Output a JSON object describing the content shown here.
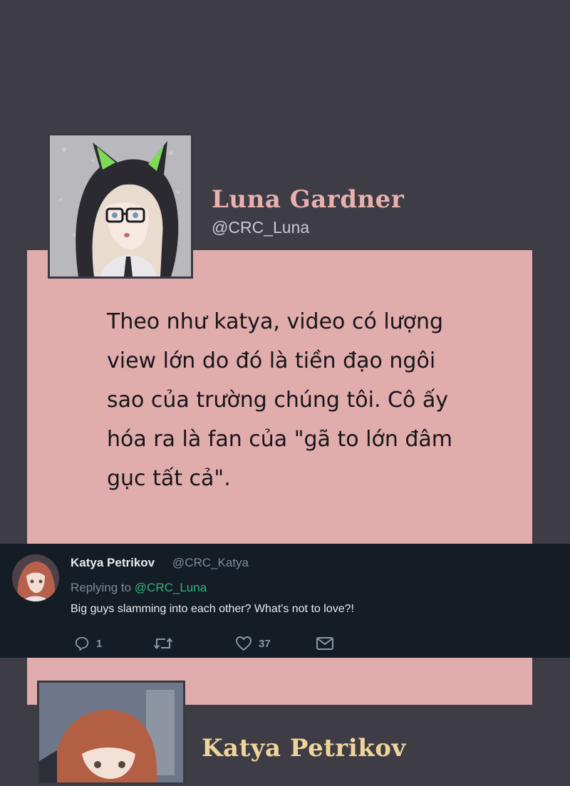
{
  "post": {
    "author_name": "Luna Gardner",
    "author_handle": "@CRC_Luna",
    "message": "Theo như katya, video có lượng view lớn do đó là tiền đạo ngôi sao của trường chúng tôi. Cô ấy hóa ra là fan của \"gã to lớn đâm gục tất cả\"."
  },
  "reply": {
    "author_name": "Katya Petrikov",
    "author_handle": "@CRC_Katya",
    "replying_prefix": "Replying to",
    "replying_to": "@CRC_Luna",
    "text": "Big guys slamming into each other? What's not to love?!",
    "actions": {
      "reply_icon": "reply-icon",
      "reply_count": "1",
      "retweet_icon": "retweet-icon",
      "retweet_count": "",
      "like_icon": "heart-icon",
      "like_count": "37",
      "dm_icon": "envelope-icon"
    }
  },
  "next_post": {
    "author_name": "Katya Petrikov"
  },
  "colors": {
    "background": "#3e3d46",
    "card": "#e0acac",
    "luna_name": "#e8b1ae",
    "katya_name": "#f1d49a",
    "reply_bar": "#141c25",
    "link_green": "#2fb57a"
  }
}
